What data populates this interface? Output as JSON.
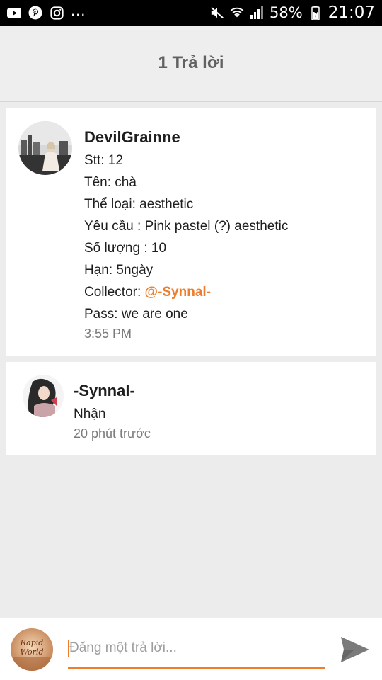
{
  "status_bar": {
    "icons": [
      "youtube-icon",
      "pinterest-icon",
      "instagram-icon"
    ],
    "more": "...",
    "battery_percent": "58%",
    "time": "21:07"
  },
  "header": {
    "title": "1 Trả lời"
  },
  "post": {
    "username": "DevilGrainne",
    "lines": {
      "stt": "Stt: 12",
      "ten": "Tên: chà",
      "the_loai": "Thể loại: aesthetic",
      "yeu_cau": "Yêu cầu : Pink pastel (?) aesthetic",
      "so_luong": "Số lượng : 10",
      "han": "Hạn: 5ngày",
      "collector_label": "Collector: ",
      "collector_mention": "@-Synnal-",
      "pass": "Pass: we are one"
    },
    "time": "3:55 PM"
  },
  "reply": {
    "username": "-Synnal-",
    "text": "Nhận",
    "time": "20 phút trước"
  },
  "composer": {
    "placeholder": "Đăng một trả lời...",
    "avatar_text": "Rapid World"
  },
  "colors": {
    "accent": "#f07d2b",
    "header_bg": "#eeeeee",
    "page_bg": "#ececec"
  }
}
